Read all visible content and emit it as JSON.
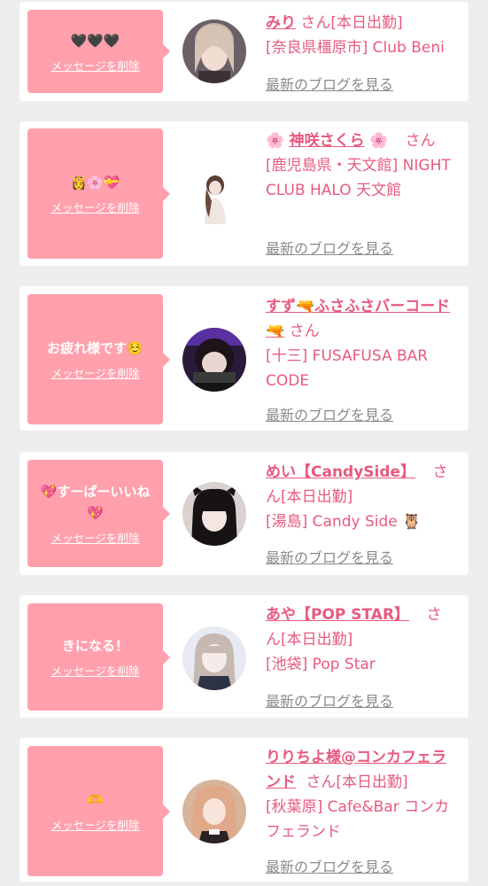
{
  "cards": [
    {
      "message": "🖤🖤🖤",
      "delete_label": "メッセージを削除",
      "name": "みり",
      "san": "さん",
      "badge": "[本日出勤]",
      "shop": "[奈良県橿原市] Club Beni",
      "blog_label": "最新のブログを見る"
    },
    {
      "message": "👸🌸💝",
      "delete_label": "メッセージを削除",
      "name_prefix": "🌸",
      "name": "神咲さくら",
      "name_suffix": "🌸",
      "san": "さん",
      "shop": "[鹿児島県・天文館] NIGHT CLUB HALO 天文館",
      "blog_label": "最新のブログを見る"
    },
    {
      "message": "お疲れ様です☺️",
      "delete_label": "メッセージを削除",
      "name_part1": "すず",
      "name_gun1": "🔫",
      "name_part2": "ふさふさバーコード",
      "name_gun2": "🔫",
      "san": "さん",
      "shop": "[十三] FUSAFUSA BAR CODE",
      "blog_label": "最新のブログを見る"
    },
    {
      "message": "💖すーぱーいいね💖",
      "delete_label": "メッセージを削除",
      "name": "めい【CandySide】",
      "san": "さん",
      "badge": "[本日出勤]",
      "shop": "[湯島] Candy Side 🦉",
      "blog_label": "最新のブログを見る"
    },
    {
      "message": "きになる！",
      "delete_label": "メッセージを削除",
      "name": "あや【POP STAR】",
      "san": "さん",
      "badge": "[本日出勤]",
      "shop": "[池袋] Pop Star",
      "blog_label": "最新のブログを見る"
    },
    {
      "message": "🫶",
      "delete_label": "メッセージを削除",
      "name": "りりちよ様@コンカフェランド",
      "san": "さん",
      "badge": "[本日出勤]",
      "shop": "[秋葉原] Cafe&Bar コンカフェランド",
      "blog_label": "最新のブログを見る"
    }
  ]
}
